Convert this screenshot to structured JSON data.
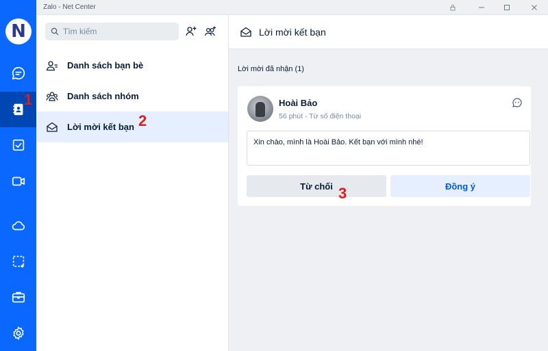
{
  "window": {
    "title": "Zalo - Net Center"
  },
  "rail": {
    "logo_letter": "N",
    "accent": "#0a68ff",
    "active_color": "#0047b3"
  },
  "search": {
    "placeholder": "Tìm kiếm"
  },
  "menu": {
    "items": [
      {
        "label": "Danh sách bạn bè",
        "icon": "person-list-icon"
      },
      {
        "label": "Danh sách nhóm",
        "icon": "group-icon"
      },
      {
        "label": "Lời mời kết bạn",
        "icon": "envelope-open-icon"
      }
    ]
  },
  "markers": {
    "one": "1",
    "two": "2",
    "three": "3"
  },
  "pane": {
    "header_title": "Lời mời kết bạn",
    "section_label": "Lời mời đã nhận (1)"
  },
  "request": {
    "name": "Hoài Bảo",
    "meta": "56 phút - Từ số điện thoại",
    "message": "Xin chào, mình là Hoài Bảo. Kết bạn với mình nhé!",
    "decline_label": "Từ chối",
    "accept_label": "Đồng ý"
  }
}
